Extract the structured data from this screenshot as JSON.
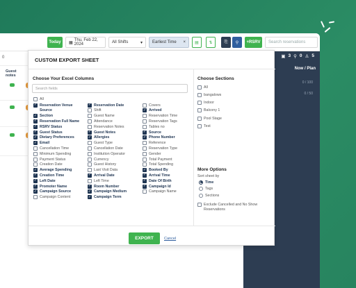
{
  "toolbar": {
    "today_label": "Today",
    "date_label": "Thu, Feb 22, 2024",
    "shift_select": "All Shifts",
    "sort_select": "Earliest Time",
    "rsrv_label": "+RSRV",
    "search_placeholder": "Search reservations"
  },
  "left_panel": {
    "count": "0",
    "col_header_1": "Guest",
    "col_header_2": "notes"
  },
  "right_panel": {
    "stat_a": "3",
    "stat_b": "0",
    "stat_c": "5",
    "header": "Now / Plan",
    "row1": "0 / 100",
    "row2": "0 / 50"
  },
  "modal": {
    "title": "CUSTOM EXPORT SHEET",
    "columns_title": "Choose Your Excel Columns",
    "search_placeholder": "Search fields",
    "all_label": "All",
    "columns": [
      [
        {
          "label": "Reservation Venue",
          "label2": "Source",
          "checked": true
        },
        {
          "label": "Section",
          "checked": true
        },
        {
          "label": "Reservation Full Name",
          "checked": true
        },
        {
          "label": "RSRV Status",
          "checked": true
        },
        {
          "label": "Guest Status",
          "checked": true
        },
        {
          "label": "Dietary Preferences",
          "checked": true
        },
        {
          "label": "Email",
          "checked": true
        },
        {
          "label": "Cancellation Time",
          "checked": false
        },
        {
          "label": "Minimum Spending",
          "checked": false
        },
        {
          "label": "Payment Status",
          "checked": false
        },
        {
          "label": "Creation Date",
          "checked": false
        },
        {
          "label": "Average Spending",
          "checked": true
        },
        {
          "label": "Creation Time",
          "checked": true
        },
        {
          "label": "Left Date",
          "checked": true
        },
        {
          "label": "Promoter Name",
          "checked": true
        },
        {
          "label": "Campaign Source",
          "checked": true
        },
        {
          "label": "Campaign Content",
          "checked": false
        }
      ],
      [
        {
          "label": "Reservation Date",
          "checked": true
        },
        {
          "label": "Shift",
          "checked": false
        },
        {
          "label": "Guest Name",
          "checked": false
        },
        {
          "label": "Attendance",
          "checked": false
        },
        {
          "label": "Reservation Notes",
          "checked": false
        },
        {
          "label": "Guest Notes",
          "checked": true
        },
        {
          "label": "Allergies",
          "checked": true
        },
        {
          "label": "Guest Type",
          "checked": false
        },
        {
          "label": "Cancellation Date",
          "checked": false
        },
        {
          "label": "Institution Operator",
          "checked": false
        },
        {
          "label": "Currency",
          "checked": false
        },
        {
          "label": "Guest History",
          "checked": false
        },
        {
          "label": "Last Visit Data",
          "checked": false
        },
        {
          "label": "Arrival Date",
          "checked": true
        },
        {
          "label": "Left Time",
          "checked": false
        },
        {
          "label": "Room Number",
          "checked": true
        },
        {
          "label": "Campaign Medium",
          "checked": true
        },
        {
          "label": "Campaign Term",
          "checked": true
        }
      ],
      [
        {
          "label": "Covers",
          "checked": false
        },
        {
          "label": "Arrived",
          "checked": true
        },
        {
          "label": "Reservation Time",
          "checked": false
        },
        {
          "label": "Reservation Tags",
          "checked": false
        },
        {
          "label": "Tables no",
          "checked": false
        },
        {
          "label": "Source",
          "checked": true
        },
        {
          "label": "Phone Number",
          "checked": true
        },
        {
          "label": "Reference",
          "checked": false
        },
        {
          "label": "Reservation Type",
          "checked": false
        },
        {
          "label": "Gender",
          "checked": false
        },
        {
          "label": "Total Payment",
          "checked": false
        },
        {
          "label": "Total Spending",
          "checked": false
        },
        {
          "label": "Booked By",
          "checked": true
        },
        {
          "label": "Arrival Time",
          "checked": true
        },
        {
          "label": "Date Of Birth",
          "checked": true
        },
        {
          "label": "Campaign Id",
          "checked": true
        },
        {
          "label": "Campaign Name",
          "checked": false
        }
      ]
    ],
    "sections_title": "Choose Sections",
    "sections": [
      {
        "label": "All",
        "checked": false
      },
      {
        "label": "bangalows",
        "checked": false
      },
      {
        "label": "Indoor",
        "checked": false
      },
      {
        "label": "Balcony 1",
        "checked": false
      },
      {
        "label": "Pool Stage",
        "checked": false
      },
      {
        "label": "Test",
        "checked": false
      }
    ],
    "more_options_title": "More Options",
    "sort_label": "Sort sheet by",
    "sort_options": [
      {
        "label": "Time",
        "selected": true
      },
      {
        "label": "Tags",
        "selected": false
      },
      {
        "label": "Sections",
        "selected": false
      }
    ],
    "exclude_label_1": "Exclude Cancelled and No Show",
    "exclude_label_2": "Reservations",
    "export_label": "EXPORT",
    "cancel_label": "Cancel"
  },
  "colors": {
    "primary_green": "#3fb34f",
    "dark_navy": "#2d3d52",
    "checkbox_navy": "#1f3552",
    "link_blue": "#2f5e9e"
  }
}
